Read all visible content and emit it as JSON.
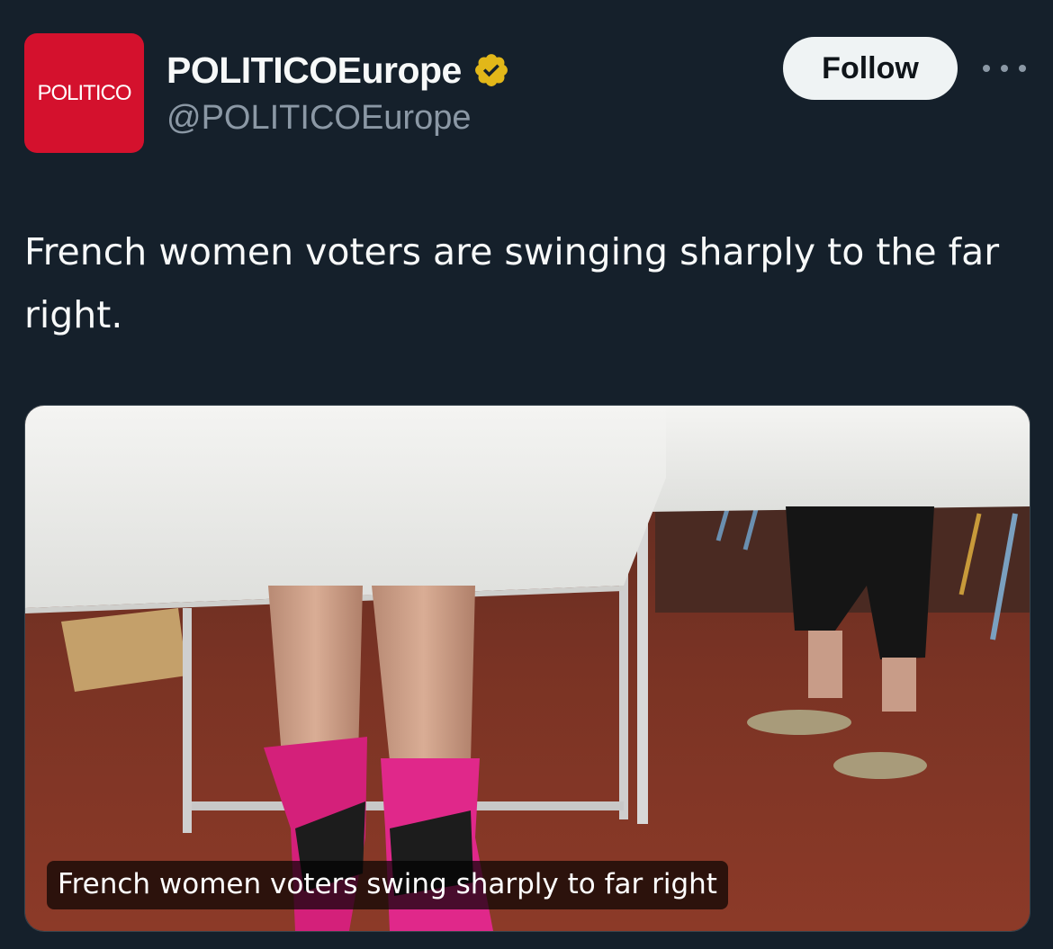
{
  "author": {
    "avatar_text": "POLITICO",
    "display_name": "POLITICOEurope",
    "handle": "@POLITICOEurope",
    "verified_badge": "verified-badge-icon",
    "avatar_color": "#d4112d",
    "badge_color": "#e2b719"
  },
  "actions": {
    "follow_label": "Follow",
    "more_icon": "more-horizontal-icon"
  },
  "tweet": {
    "text": "French women voters are swinging sharply to the far right."
  },
  "media": {
    "caption": "French women voters swing sharply to far right"
  },
  "theme": {
    "background": "#15202b",
    "text_primary": "#f7f9f9",
    "text_secondary": "#8b98a5",
    "button_bg": "#eff3f4"
  }
}
